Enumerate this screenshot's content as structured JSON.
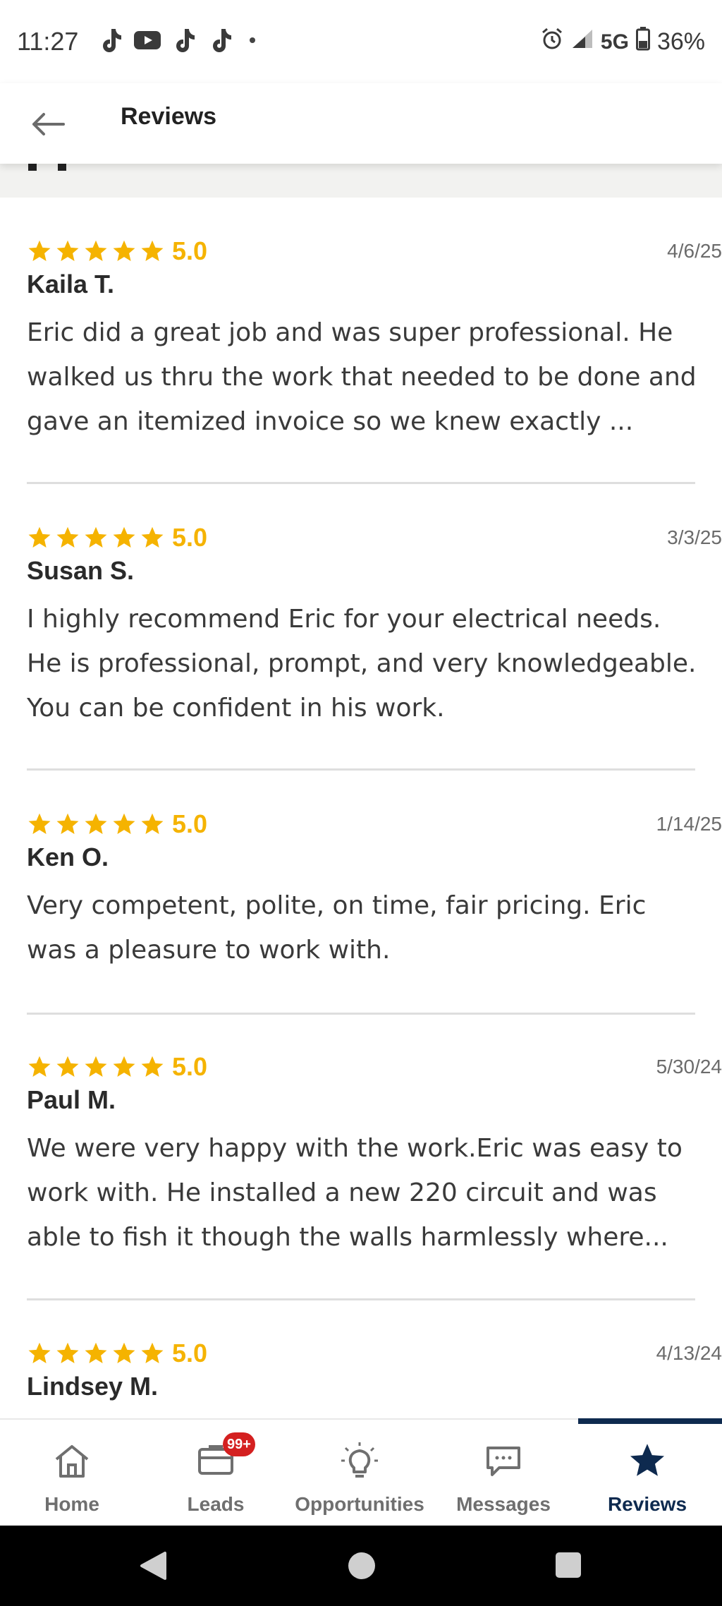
{
  "status_bar": {
    "time": "11:27",
    "network": "5G",
    "battery": "36%",
    "app_icons": [
      "tiktok-icon",
      "youtube-icon",
      "tiktok-icon",
      "tiktok-icon"
    ]
  },
  "header": {
    "title": "Reviews"
  },
  "colors": {
    "star": "#f5b300",
    "accent": "#0e2a4f",
    "badge": "#d42020"
  },
  "reviews": [
    {
      "rating": "5.0",
      "stars": 5,
      "date": "4/6/25",
      "name": "Kaila T.",
      "text": "Eric did a great job and was super professional. He walked us thru the work that needed to be done and gave an itemized invoice so we knew exactly ..."
    },
    {
      "rating": "5.0",
      "stars": 5,
      "date": "3/3/25",
      "name": "Susan S.",
      "text": "I highly recommend Eric for your electrical needs. He is professional, prompt, and very knowledgeable. You can be confident in his work."
    },
    {
      "rating": "5.0",
      "stars": 5,
      "date": "1/14/25",
      "name": "Ken O.",
      "text": "Very competent, polite, on time, fair pricing. Eric was a pleasure to work with."
    },
    {
      "rating": "5.0",
      "stars": 5,
      "date": "5/30/24",
      "name": "Paul M.",
      "text": "We were very happy with the work.Eric was easy to work with. He installed a new 220 circuit and was able to fish it though the walls harmlessly where..."
    },
    {
      "rating": "5.0",
      "stars": 5,
      "date": "4/13/24",
      "name": "Lindsey M.",
      "text": ""
    }
  ],
  "nav": {
    "items": [
      {
        "label": "Home",
        "icon": "home-icon"
      },
      {
        "label": "Leads",
        "icon": "leads-icon",
        "badge": "99+"
      },
      {
        "label": "Opportunities",
        "icon": "lightbulb-icon"
      },
      {
        "label": "Messages",
        "icon": "messages-icon"
      },
      {
        "label": "Reviews",
        "icon": "star-icon",
        "active": true
      }
    ]
  }
}
